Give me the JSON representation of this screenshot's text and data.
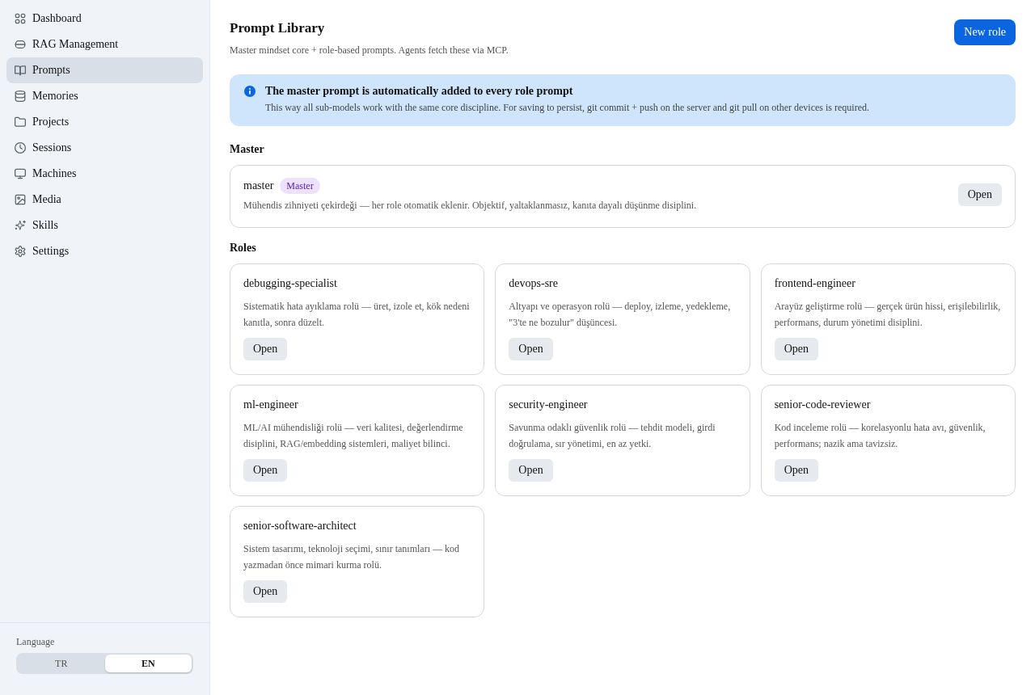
{
  "sidebar": {
    "nav_items": [
      {
        "label": "Dashboard",
        "selected": false
      },
      {
        "label": "RAG Management",
        "selected": false
      },
      {
        "label": "Prompts",
        "selected": true
      },
      {
        "label": "Memories",
        "selected": false
      },
      {
        "label": "Projects",
        "selected": false
      },
      {
        "label": "Sessions",
        "selected": false
      },
      {
        "label": "Machines",
        "selected": false
      },
      {
        "label": "Media",
        "selected": false
      },
      {
        "label": "Skills",
        "selected": false
      },
      {
        "label": "Settings",
        "selected": false
      }
    ],
    "language": {
      "label": "Language",
      "options": [
        {
          "label": "TR",
          "selected": false
        },
        {
          "label": "EN",
          "selected": true
        }
      ]
    }
  },
  "header": {
    "title": "Prompt Library",
    "subtitle": "Master mindset core + role-based prompts. Agents fetch these via MCP.",
    "button": "New role"
  },
  "info_banner": {
    "title": "The master prompt is automatically added to every role prompt",
    "text": "This way all sub-models work with the same core discipline. For saving to persist, git commit + push on the server and git pull on other devices is required."
  },
  "master_section": {
    "heading": "Master",
    "card": {
      "name": "master",
      "badge": "Master",
      "description": "Mühendis zihniyeti çekirdeği — her role otomatik eklenir. Objektif, yaltaklanmasız, kanıta dayalı düşünme disiplini.",
      "button": "Open"
    }
  },
  "roles_section": {
    "heading": "Roles",
    "cards": [
      {
        "name": "debugging-specialist",
        "description": "Sistematik hata ayıklama rolü — üret, izole et, kök nedeni kanıtla, sonra düzelt.",
        "button": "Open"
      },
      {
        "name": "devops-sre",
        "description": "Altyapı ve operasyon rolü — deploy, izleme, yedekleme, \"3'te ne bozulur\" düşüncesi.",
        "button": "Open"
      },
      {
        "name": "frontend-engineer",
        "description": "Arayüz geliştirme rolü — gerçek ürün hissi, erişilebilirlik, performans, durum yönetimi disiplini.",
        "button": "Open"
      },
      {
        "name": "ml-engineer",
        "description": "ML/AI mühendisliği rolü — veri kalitesi, değerlendirme disiplini, RAG/embedding sistemleri, maliyet bilinci.",
        "button": "Open"
      },
      {
        "name": "security-engineer",
        "description": "Savunma odaklı güvenlik rolü — tehdit modeli, girdi doğrulama, sır yönetimi, en az yetki.",
        "button": "Open"
      },
      {
        "name": "senior-code-reviewer",
        "description": "Kod inceleme rolü — korelasyonlu hata avı, güvenlik, performans; nazik ama tavizsiz.",
        "button": "Open"
      },
      {
        "name": "senior-software-architect",
        "description": "Sistem tasarımı, teknoloji seçimi, sınır tanımları — kod yazmadan önce mimari kurma rolü.",
        "button": "Open"
      }
    ]
  }
}
